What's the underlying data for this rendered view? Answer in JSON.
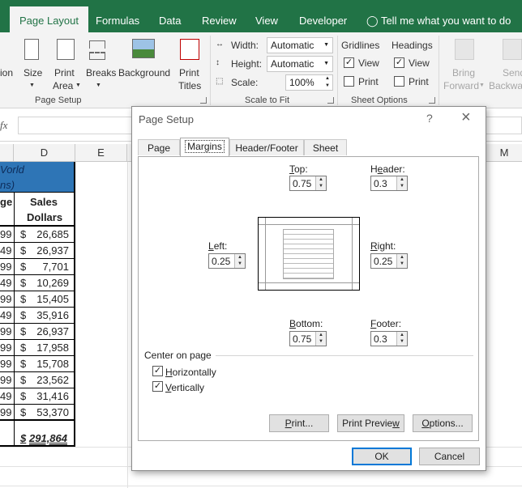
{
  "ribbon": {
    "tabs": [
      {
        "label": "Page Layout",
        "active": true
      },
      {
        "label": "Formulas"
      },
      {
        "label": "Data"
      },
      {
        "label": "Review"
      },
      {
        "label": "View"
      },
      {
        "label": "Developer"
      }
    ],
    "tell_me": "Tell me what you want to do",
    "page_setup": {
      "orientation_partial": "ion",
      "size": "Size",
      "print_area_1": "Print",
      "print_area_2": "Area",
      "breaks": "Breaks",
      "background": "Background",
      "print_titles_1": "Print",
      "print_titles_2": "Titles",
      "group": "Page Setup"
    },
    "scale_to_fit": {
      "width_label": "Width:",
      "width_value": "Automatic",
      "height_label": "Height:",
      "height_value": "Automatic",
      "scale_label": "Scale:",
      "scale_value": "100%",
      "group": "Scale to Fit"
    },
    "sheet_options": {
      "gridlines": "Gridlines",
      "headings": "Headings",
      "view": "View",
      "print": "Print",
      "group": "Sheet Options",
      "gridlines_view_checked": true,
      "gridlines_print_checked": false,
      "headings_view_checked": true,
      "headings_print_checked": false
    },
    "arrange": {
      "bring_forward_1": "Bring",
      "bring_forward_2": "Forward",
      "send_backward_1": "Send",
      "send_backward_2": "Backwa"
    }
  },
  "formula_bar": {
    "fx": "fx"
  },
  "columns": [
    "D",
    "E",
    "M"
  ],
  "sheet": {
    "header_row1_c": "Vorld",
    "header_row2_c": "ns)",
    "header_c_1": "ge",
    "header_c_2": "",
    "header_d_1": "Sales",
    "header_d_2": "Dollars",
    "rows": [
      {
        "c": "99",
        "d": "26,685"
      },
      {
        "c": "49",
        "d": "26,937"
      },
      {
        "c": "99",
        "d": "7,701"
      },
      {
        "c": "49",
        "d": "10,269"
      },
      {
        "c": "99",
        "d": "15,405"
      },
      {
        "c": "49",
        "d": "35,916"
      },
      {
        "c": "99",
        "d": "26,937"
      },
      {
        "c": "99",
        "d": "17,958"
      },
      {
        "c": "99",
        "d": "15,708"
      },
      {
        "c": "99",
        "d": "23,562"
      },
      {
        "c": "49",
        "d": "31,416"
      },
      {
        "c": "99",
        "d": "53,370"
      }
    ],
    "currency": "$",
    "total": "291,864"
  },
  "dialog": {
    "title": "Page Setup",
    "help": "?",
    "close": "×",
    "tabs": [
      "Page",
      "Margins",
      "Header/Footer",
      "Sheet"
    ],
    "active_tab": "Margins",
    "top_label": "Top:",
    "top": "0.75",
    "header_label": "Header:",
    "header": "0.3",
    "left_label": "Left:",
    "left": "0.25",
    "right_label": "Right:",
    "right": "0.25",
    "bottom_label": "Bottom:",
    "bottom": "0.75",
    "footer_label": "Footer:",
    "footer": "0.3",
    "center_on_page": "Center on page",
    "horizontally": "Horizontally",
    "vertically": "Vertically",
    "horizontally_checked": true,
    "vertically_checked": true,
    "print_btn": "Print...",
    "print_preview_btn": "Print Preview",
    "options_btn": "Options...",
    "ok": "OK",
    "cancel": "Cancel"
  },
  "colors": {
    "excel_green": "#217346",
    "header_fill": "#2e75b6",
    "focus_blue": "#0078d7"
  }
}
